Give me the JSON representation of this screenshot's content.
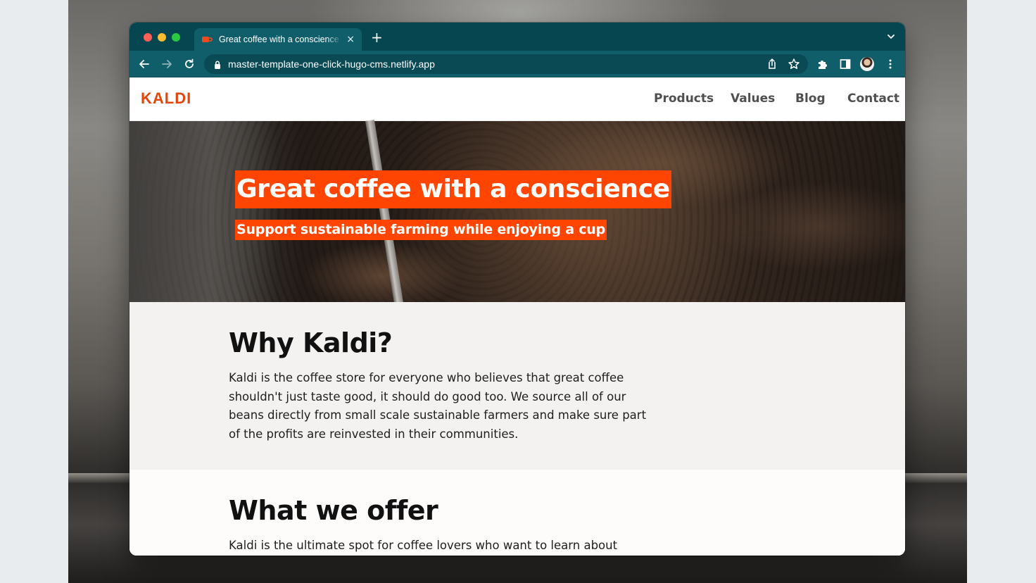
{
  "browser": {
    "tab": {
      "title": "Great coffee with a conscience",
      "close_glyph": "×"
    },
    "new_tab_glyph": "+",
    "address_bar": {
      "url": "master-template-one-click-hugo-cms.netlify.app"
    },
    "icons": {
      "back": "back-arrow-icon",
      "forward": "forward-arrow-icon",
      "reload": "reload-icon",
      "lock": "lock-icon",
      "share": "share-icon",
      "bookmark": "star-icon",
      "extensions": "puzzle-icon",
      "side_panel": "side-panel-icon",
      "menu": "kebab-menu-icon",
      "tab_list": "chevron-down-icon"
    },
    "colors": {
      "frame": "#054651",
      "toolbar": "#0f5e69"
    }
  },
  "site": {
    "logo": "KALDI",
    "nav": [
      {
        "label": "Products"
      },
      {
        "label": "Values"
      },
      {
        "label": "Blog"
      },
      {
        "label": "Contact"
      }
    ],
    "hero": {
      "title": "Great coffee with a conscience",
      "subtitle": "Support sustainable farming while enjoying a cup"
    },
    "sections": {
      "why": {
        "heading": "Why Kaldi?",
        "body_lines": [
          "Kaldi is the coffee store for everyone who believes that great coffee",
          "shouldn't just taste good, it should do good too. We source all of our",
          "beans directly from small scale sustainable farmers and make sure part",
          "of the profits are reinvested in their communities."
        ]
      },
      "offer": {
        "heading": "What we offer",
        "body_lines": [
          "Kaldi is the ultimate spot for coffee lovers who want to learn about"
        ]
      }
    },
    "colors": {
      "brand": "#e4450b",
      "hero_highlight": "#ff4501",
      "section_alt": "#f3f2f0"
    }
  }
}
